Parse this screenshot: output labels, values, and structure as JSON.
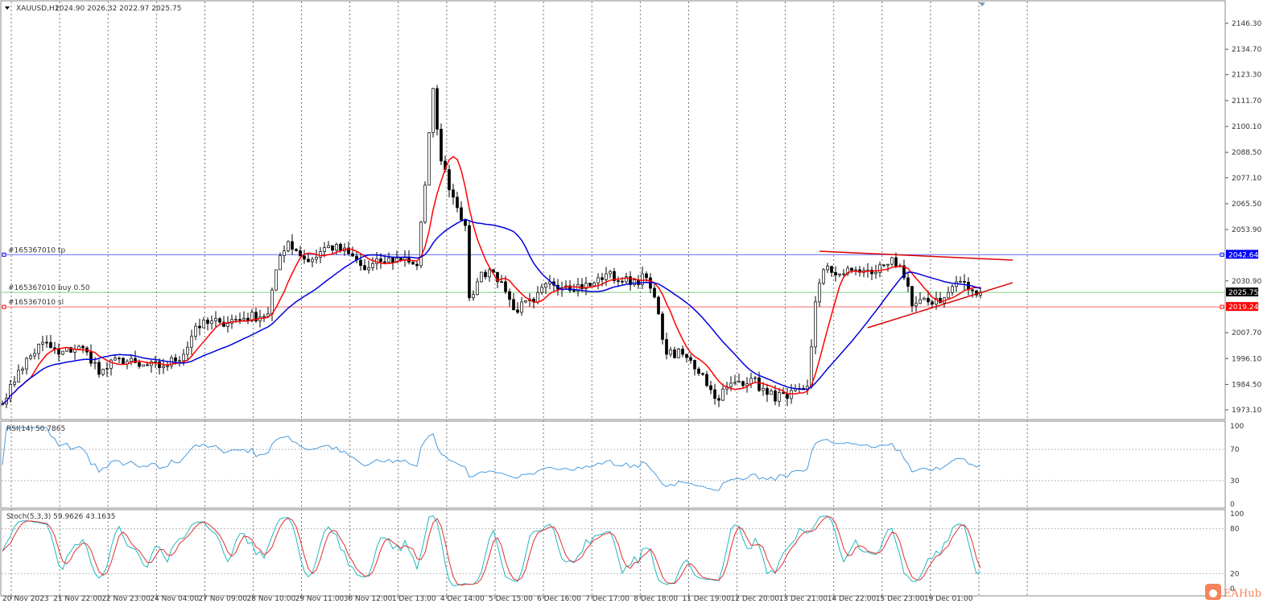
{
  "header": {
    "symbol": "XAUUSD,H1",
    "ohlc": "2024.90 2026.32 2022.97 2025.75"
  },
  "trade_lines": {
    "tp": {
      "label": "#165367010 tp",
      "price": 2042.64,
      "price_label": "2042.64",
      "color": "#0000ff"
    },
    "buy": {
      "label": "#165367010 buy 0.50",
      "price": 2025.75,
      "price_label": "2025.75",
      "color": "#00aa00"
    },
    "sl": {
      "label": "#165367010 sl",
      "price": 2019.24,
      "price_label": "2019.24",
      "color": "#ff0000"
    }
  },
  "price_axis": [
    "2146.30",
    "2134.70",
    "2123.30",
    "2111.70",
    "2100.10",
    "2088.50",
    "2077.10",
    "2065.50",
    "2053.90",
    "2030.90",
    "2007.70",
    "1996.10",
    "1984.50",
    "1973.10"
  ],
  "time_axis": [
    "20 Nov 2023",
    "21 Nov 22:00",
    "22 Nov 23:00",
    "24 Nov 04:00",
    "27 Nov 09:00",
    "28 Nov 10:00",
    "29 Nov 11:00",
    "30 Nov 12:00",
    "1 Dec 13:00",
    "4 Dec 14:00",
    "5 Dec 15:00",
    "6 Dec 16:00",
    "7 Dec 17:00",
    "8 Dec 18:00",
    "11 Dec 19:00",
    "12 Dec 20:00",
    "13 Dec 21:00",
    "14 Dec 22:00",
    "15 Dec 23:00",
    "19 Dec 01:00"
  ],
  "rsi": {
    "label": "RSI(14) 50.7865",
    "levels": [
      "100",
      "70",
      "30",
      "0"
    ],
    "color": "#4a9be0"
  },
  "stoch": {
    "label": "Stoch(5,3,3) 59.9626 43.1635",
    "levels": [
      "100",
      "80",
      "20",
      "0"
    ],
    "main_color": "#22b8c0",
    "signal_color": "#e03030"
  },
  "watermark": "EAHub",
  "chart_data": {
    "type": "candlestick",
    "title": "XAUUSD,H1",
    "ylim": [
      1973.1,
      2146.3
    ],
    "ma_fast_color": "#ff0000",
    "ma_slow_color": "#0000dd",
    "close_waypoints": [
      [
        1,
        1978.2
      ],
      [
        4,
        1990.8
      ],
      [
        10,
        2003.4
      ],
      [
        14,
        1998.0
      ],
      [
        19,
        2001.6
      ],
      [
        23,
        1994.4
      ],
      [
        24,
        1989.0
      ],
      [
        29,
        1996.2
      ],
      [
        34,
        1992.6
      ],
      [
        40,
        1992.6
      ],
      [
        45,
        1998.0
      ],
      [
        48,
        2010.6
      ],
      [
        54,
        2012.4
      ],
      [
        60,
        2014.2
      ],
      [
        66,
        2016.1
      ],
      [
        68,
        2035.9
      ],
      [
        71,
        2048.5
      ],
      [
        76,
        2039.5
      ],
      [
        81,
        2046.7
      ],
      [
        86,
        2043.1
      ],
      [
        90,
        2035.9
      ],
      [
        94,
        2039.5
      ],
      [
        100,
        2041.3
      ],
      [
        103,
        2037.7
      ],
      [
        105,
        2073.8
      ],
      [
        107,
        2117.1
      ],
      [
        109,
        2084.6
      ],
      [
        112,
        2068.4
      ],
      [
        115,
        2055.7
      ],
      [
        116,
        2023.3
      ],
      [
        118,
        2030.5
      ],
      [
        121,
        2035.9
      ],
      [
        124,
        2030.5
      ],
      [
        127,
        2017.9
      ],
      [
        132,
        2021.5
      ],
      [
        136,
        2030.5
      ],
      [
        140,
        2028.7
      ],
      [
        146,
        2028.7
      ],
      [
        150,
        2034.1
      ],
      [
        154,
        2030.5
      ],
      [
        160,
        2032.3
      ],
      [
        163,
        2016.1
      ],
      [
        165,
        1998.0
      ],
      [
        169,
        1998.0
      ],
      [
        174,
        1989.0
      ],
      [
        177,
        1978.2
      ],
      [
        182,
        1985.4
      ],
      [
        186,
        1987.2
      ],
      [
        190,
        1980.0
      ],
      [
        195,
        1978.2
      ],
      [
        200,
        1983.6
      ],
      [
        202,
        2021.5
      ],
      [
        204,
        2035.9
      ],
      [
        209,
        2034.1
      ],
      [
        212,
        2035.9
      ],
      [
        216,
        2034.1
      ],
      [
        221,
        2041.3
      ],
      [
        224,
        2032.3
      ],
      [
        226,
        2019.7
      ],
      [
        230,
        2021.5
      ],
      [
        234,
        2023.3
      ],
      [
        237,
        2030.5
      ],
      [
        240,
        2026.9
      ],
      [
        243,
        2025.75
      ]
    ],
    "trendlines": [
      {
        "from": [
          203,
          2044.2
        ],
        "to": [
          251,
          2040.2
        ],
        "color": "#dd0000"
      },
      {
        "from": [
          215,
          2009.9
        ],
        "to": [
          251,
          2030.1
        ],
        "color": "#dd0000"
      }
    ]
  }
}
